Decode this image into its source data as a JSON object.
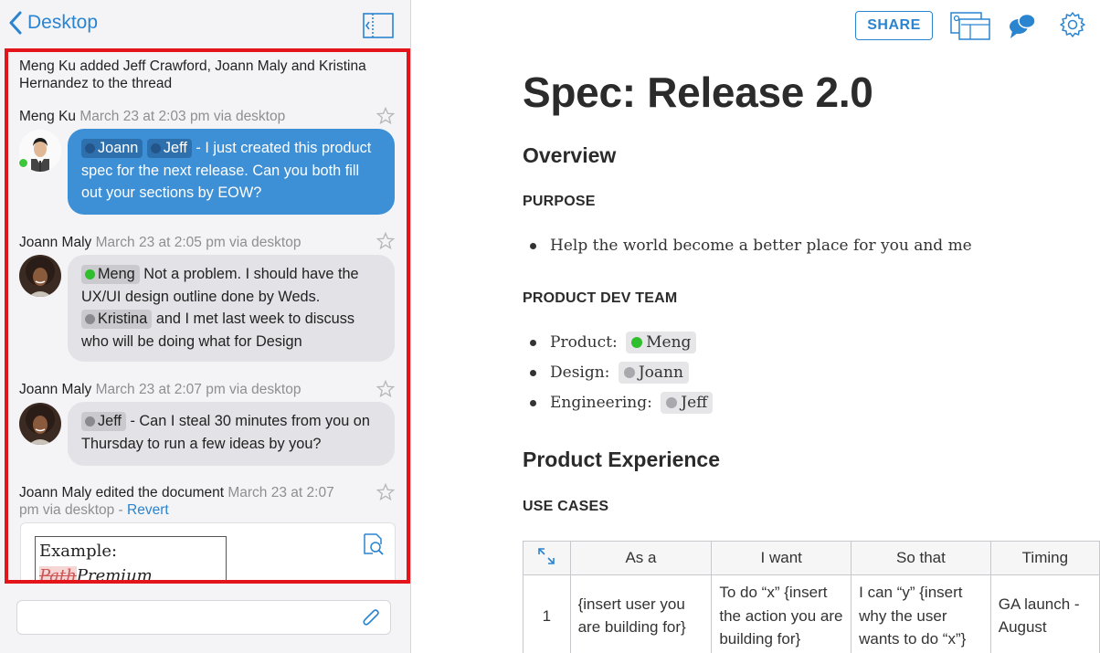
{
  "left": {
    "back_label": "Desktop",
    "system_message": "added Jeff Crawford, Joann Maly and Kristina Hernandez to the thread",
    "system_actor": "Meng Ku",
    "messages": [
      {
        "author": "Meng Ku",
        "time": "March 23 at 2:03 pm via desktop",
        "mentions": [
          "Joann",
          "Jeff"
        ],
        "text_line1": " - I just created this",
        "text_rest": "product spec for the next release. Can you both fill out your sections by EOW?"
      },
      {
        "author": "Joann Maly",
        "time": "March 23 at 2:05 pm via desktop",
        "mention1": "Meng",
        "text1": " Not a problem. I should have the UX/UI design outline done by Weds.",
        "mention2": "Kristina",
        "text2": " and I met last week to discuss who will be doing what for Design"
      },
      {
        "author": "Joann Maly",
        "time": "March 23 at 2:07 pm via desktop",
        "mention": "Jeff",
        "text": " - Can I steal 30 minutes from you on Thursday to run a few ideas by you?"
      }
    ],
    "edit_event": {
      "author": "Joann Maly",
      "action": "edited the document",
      "time_a": "March 23 at",
      "time_b": "2:07 pm via desktop",
      "sep": " - ",
      "revert": "Revert",
      "preview_line1": "Example:",
      "preview_struck": "Path",
      "preview_inserted": "Premium subscriber"
    },
    "composer_placeholder": ""
  },
  "right": {
    "share_label": "SHARE",
    "title": "Spec: Release 2.0",
    "overview": "Overview",
    "purpose_heading": "PURPOSE",
    "purpose_items": [
      "Help the world become a better place for you and me"
    ],
    "team_heading": "PRODUCT DEV TEAM",
    "team": [
      {
        "role": "Product:",
        "person": "Meng"
      },
      {
        "role": "Design:",
        "person": "Joann"
      },
      {
        "role": "Engineering:",
        "person": "Jeff"
      }
    ],
    "experience_heading": "Product Experience",
    "use_cases_heading": "USE CASES",
    "table": {
      "headers": [
        "As a",
        "I want",
        "So that",
        "Timing"
      ],
      "rows": [
        [
          "1",
          "{insert user you are building for}",
          "To do “x” {insert the action you are building for}",
          "I can “y” {insert why the user wants to do “x”}",
          "GA launch - August"
        ]
      ]
    }
  },
  "colors": {
    "accent": "#2a84d0",
    "highlight_border": "#e3151b",
    "blue_bubble": "#3d8fd6",
    "gray_bubble": "#e2e2e7",
    "online": "#3ec63a"
  },
  "icons": [
    "chevron-left-icon",
    "collapse-panel-icon",
    "star-icon",
    "preview-search-icon",
    "paperclip-icon",
    "presentation-icon",
    "chat-bubbles-icon",
    "gear-icon",
    "expand-icon"
  ]
}
